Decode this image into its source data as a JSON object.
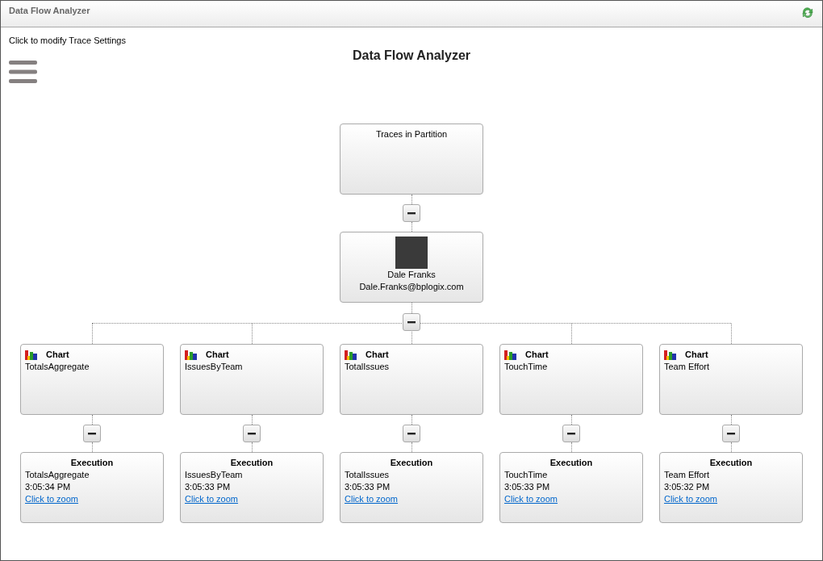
{
  "window": {
    "title": "Data Flow Analyzer"
  },
  "settings_link": "Click to modify Trace Settings",
  "heading": "Data Flow Analyzer",
  "root": {
    "title": "Traces in Partition",
    "expanded": true
  },
  "user": {
    "name": "Dale Franks",
    "email": "Dale.Franks@bplogix.com",
    "expanded": true
  },
  "charts": [
    {
      "kind_label": "Chart",
      "name": "TotalsAggregate",
      "expanded": true,
      "execution": {
        "title": "Execution",
        "name": "TotalsAggregate",
        "time": "3:05:34 PM",
        "link": "Click to zoom"
      }
    },
    {
      "kind_label": "Chart",
      "name": "IssuesByTeam",
      "expanded": true,
      "execution": {
        "title": "Execution",
        "name": "IssuesByTeam",
        "time": "3:05:33 PM",
        "link": "Click to zoom"
      }
    },
    {
      "kind_label": "Chart",
      "name": "TotalIssues",
      "expanded": true,
      "execution": {
        "title": "Execution",
        "name": "TotalIssues",
        "time": "3:05:33 PM",
        "link": "Click to zoom"
      }
    },
    {
      "kind_label": "Chart",
      "name": "TouchTime",
      "expanded": true,
      "execution": {
        "title": "Execution",
        "name": "TouchTime",
        "time": "3:05:33 PM",
        "link": "Click to zoom"
      }
    },
    {
      "kind_label": "Chart",
      "name": "Team Effort",
      "expanded": true,
      "execution": {
        "title": "Execution",
        "name": "Team Effort",
        "time": "3:05:32 PM",
        "link": "Click to zoom"
      }
    }
  ]
}
